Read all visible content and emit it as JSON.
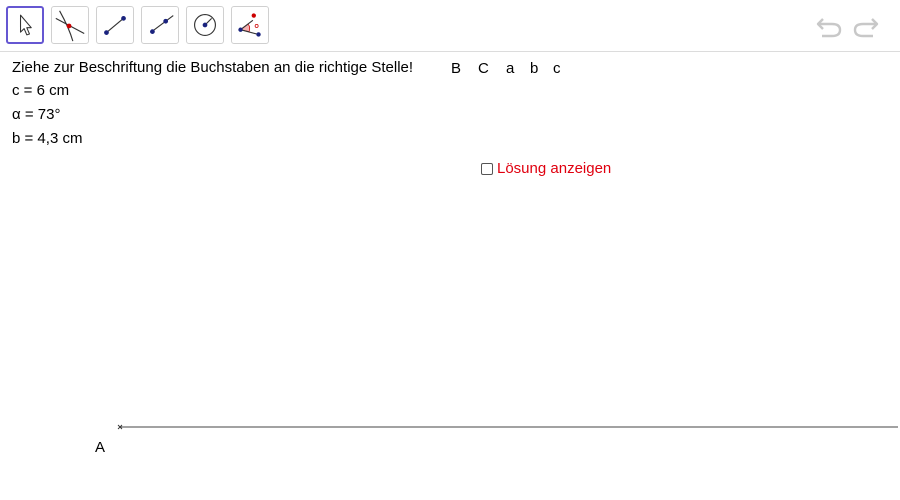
{
  "toolbar": {
    "tools": [
      {
        "name": "move",
        "icon": "arrow-cursor-icon",
        "selected": true
      },
      {
        "name": "intersect",
        "icon": "intersect-icon",
        "selected": false
      },
      {
        "name": "segment",
        "icon": "segment-icon",
        "selected": false
      },
      {
        "name": "segment-fixed-length",
        "icon": "segment-fixed-length-icon",
        "selected": false
      },
      {
        "name": "circle-center-radius",
        "icon": "circle-center-radius-icon",
        "selected": false
      },
      {
        "name": "angle-given-size",
        "icon": "angle-given-size-icon",
        "selected": false
      }
    ],
    "undo_icon": "undo-icon",
    "redo_icon": "redo-icon"
  },
  "instruction": "Ziehe zur Beschriftung die Buchstaben an die richtige Stelle!",
  "labels": [
    "B",
    "C",
    "a",
    "b",
    "c"
  ],
  "given": {
    "c": "c = 6 cm",
    "alpha": "α = 73°",
    "b": "b = 4,3 cm"
  },
  "solution_checkbox": {
    "label": "Lösung anzeigen",
    "checked": false,
    "color": "#e0000f"
  },
  "point_label": "A",
  "accent_color": "#6557d2"
}
